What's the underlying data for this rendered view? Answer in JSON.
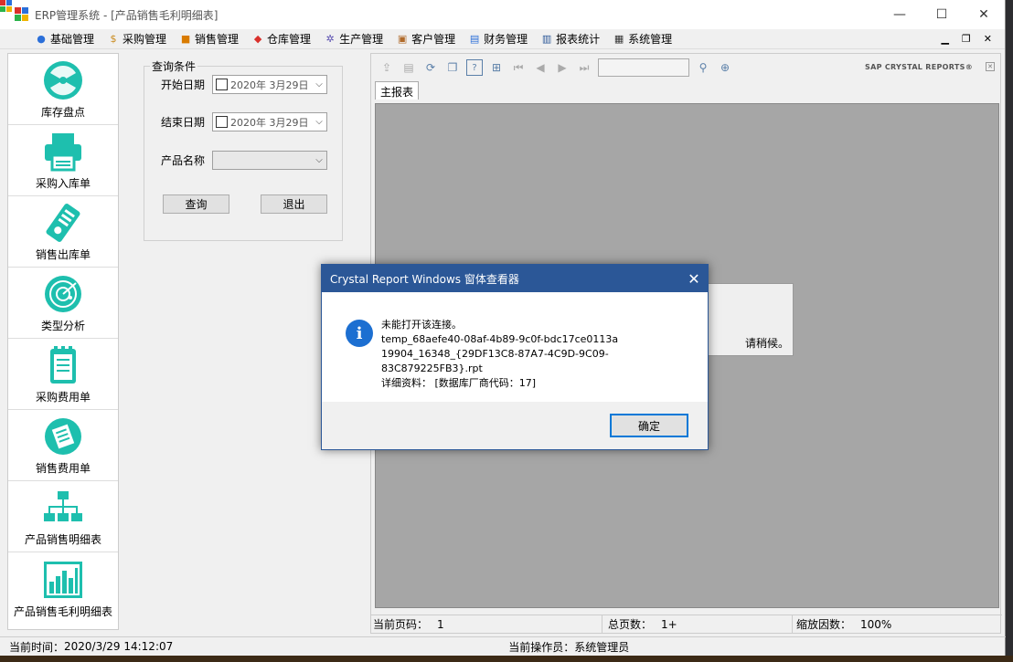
{
  "window": {
    "title": "ERP管理系统 - [产品销售毛利明细表]",
    "minimize": "—",
    "maximize": "☐",
    "close": "✕"
  },
  "menu": [
    {
      "label": "基础管理",
      "icon": "person-icon"
    },
    {
      "label": "采购管理",
      "icon": "money-bag-icon"
    },
    {
      "label": "销售管理",
      "icon": "sales-icon"
    },
    {
      "label": "仓库管理",
      "icon": "warehouse-icon"
    },
    {
      "label": "生产管理",
      "icon": "gear-icon"
    },
    {
      "label": "客户管理",
      "icon": "customer-icon"
    },
    {
      "label": "财务管理",
      "icon": "finance-icon"
    },
    {
      "label": "报表统计",
      "icon": "report-icon"
    },
    {
      "label": "系统管理",
      "icon": "system-icon"
    }
  ],
  "sidebar": {
    "items": [
      {
        "label": "库存盘点",
        "icon": "radiation-icon"
      },
      {
        "label": "采购入库单",
        "icon": "printer-icon"
      },
      {
        "label": "销售出库单",
        "icon": "receipt-icon"
      },
      {
        "label": "类型分析",
        "icon": "radar-icon"
      },
      {
        "label": "采购费用单",
        "icon": "notepad-icon"
      },
      {
        "label": "销售费用单",
        "icon": "list-icon"
      },
      {
        "label": "产品销售明细表",
        "icon": "org-chart-icon"
      },
      {
        "label": "产品销售毛利明细表",
        "icon": "bar-chart-icon"
      }
    ]
  },
  "query": {
    "legend": "查询条件",
    "start_label": "开始日期",
    "start_value": "2020年  3月29日",
    "end_label": "结束日期",
    "end_value": "2020年  3月29日",
    "product_label": "产品名称",
    "product_value": "",
    "query_button": "查询",
    "exit_button": "退出"
  },
  "viewer": {
    "brand": "SAP CRYSTAL REPORTS®",
    "tab": "主报表",
    "wait_text": "请稍候。",
    "page_label": "当前页码：",
    "page_value": "1",
    "total_label": "总页数：",
    "total_value": "1+",
    "zoom_label": "缩放因数：",
    "zoom_value": "100%"
  },
  "dialog": {
    "title": "Crystal Report Windows 窗体查看器",
    "line1": "未能打开该连接。",
    "line2": "temp_68aefe40-08af-4b89-9c0f-bdc17ce0113a",
    "line3": "19904_16348_{29DF13C8-87A7-4C9D-9C09-83C879225FB3}.rpt",
    "line4": "详细资料：  [数据库厂商代码：17]",
    "ok_button": "确定"
  },
  "status": {
    "time_label": "当前时间：",
    "time_value": "2020/3/29 14:12:07",
    "operator_label": "当前操作员：",
    "operator_value": "系统管理员"
  },
  "colors": {
    "accent": "#1ebfae",
    "dialog_title": "#2b5797",
    "info": "#1c6fd1"
  }
}
